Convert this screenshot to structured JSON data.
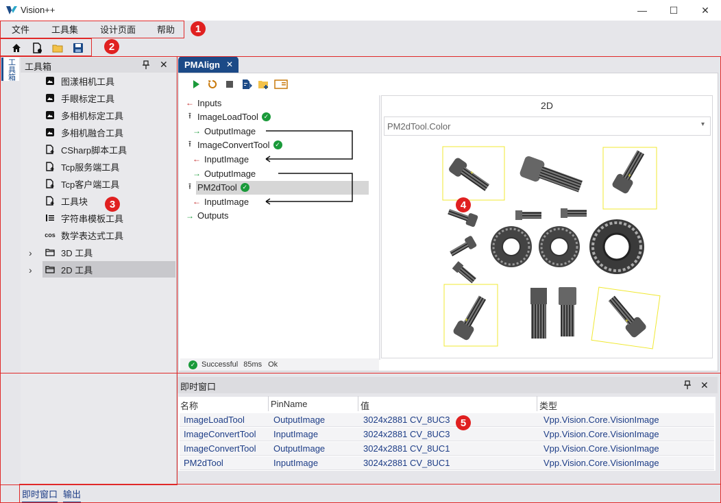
{
  "window": {
    "title": "Vision++",
    "minimize_glyph": "—",
    "maximize_glyph": "☐",
    "close_glyph": "✕"
  },
  "menu": [
    "文件",
    "工具集",
    "设计页面",
    "帮助"
  ],
  "toolbar": {
    "icons": [
      "home-icon",
      "new-file-icon",
      "open-folder-icon",
      "save-icon"
    ]
  },
  "side_strip": {
    "tab_label": "工具箱"
  },
  "toolbox": {
    "title": "工具箱",
    "pin_glyph": "📌",
    "close_glyph": "✕",
    "items": [
      {
        "label": "图漾相机工具",
        "icon": "camera-icon"
      },
      {
        "label": "手眼标定工具",
        "icon": "camera-icon"
      },
      {
        "label": "多相机标定工具",
        "icon": "camera-icon"
      },
      {
        "label": "多相机融合工具",
        "icon": "camera-icon"
      },
      {
        "label": "CSharp脚本工具",
        "icon": "script-icon"
      },
      {
        "label": "Tcp服务端工具",
        "icon": "script-icon"
      },
      {
        "label": "Tcp客户端工具",
        "icon": "script-icon"
      },
      {
        "label": "工具块",
        "icon": "script-icon"
      },
      {
        "label": "字符串模板工具",
        "icon": "list-icon"
      },
      {
        "label": "数学表达式工具",
        "icon": "cos-icon",
        "icon_text": "cos"
      }
    ],
    "folders": [
      {
        "label": "3D 工具",
        "expander": "›"
      },
      {
        "label": "2D 工具",
        "expander": "›",
        "selected": true
      }
    ]
  },
  "document": {
    "tab_label": "PMAlign",
    "tab_close": "✕",
    "run_icons": [
      "run-icon",
      "reset-icon",
      "stop-icon",
      "export-icon",
      "folder-add-icon",
      "panel-icon"
    ],
    "flow": [
      {
        "text": "Inputs",
        "arrow": "←",
        "arrow_color": "#c02020",
        "indent": 0
      },
      {
        "text": "ImageLoadTool",
        "arrow": "⭱",
        "arrow_color": "#333333",
        "indent": 0,
        "ok": true
      },
      {
        "text": "OutputImage",
        "arrow": "→",
        "arrow_color": "#1a9a3a",
        "indent": 1
      },
      {
        "text": "ImageConvertTool",
        "arrow": "⭱",
        "arrow_color": "#333333",
        "indent": 0,
        "ok": true
      },
      {
        "text": "InputImage",
        "arrow": "←",
        "arrow_color": "#c02020",
        "indent": 1
      },
      {
        "text": "OutputImage",
        "arrow": "→",
        "arrow_color": "#1a9a3a",
        "indent": 1
      },
      {
        "text": "PM2dTool",
        "arrow": "⭱",
        "arrow_color": "#333333",
        "indent": 0,
        "ok": true,
        "selected": true
      },
      {
        "text": "InputImage",
        "arrow": "←",
        "arrow_color": "#c02020",
        "indent": 1
      },
      {
        "text": "Outputs",
        "arrow": "→",
        "arrow_color": "#1a9a3a",
        "indent": 0
      }
    ],
    "ok_glyph": "✓",
    "status": {
      "result": "Successful",
      "time": "85ms",
      "message": "Ok"
    },
    "view": {
      "title": "2D",
      "select_value": "PM2dTool.Color",
      "select_arrow": "▾"
    }
  },
  "output": {
    "title": "即时窗口",
    "pin_glyph": "📌",
    "close_glyph": "✕",
    "columns": [
      "名称",
      "PinName",
      "值",
      "类型"
    ],
    "rows": [
      [
        "ImageLoadTool",
        "OutputImage",
        "3024x2881 CV_8UC3",
        "Vpp.Vision.Core.VisionImage"
      ],
      [
        "ImageConvertTool",
        "InputImage",
        "3024x2881 CV_8UC3",
        "Vpp.Vision.Core.VisionImage"
      ],
      [
        "ImageConvertTool",
        "OutputImage",
        "3024x2881 CV_8UC1",
        "Vpp.Vision.Core.VisionImage"
      ],
      [
        "PM2dTool",
        "InputImage",
        "3024x2881 CV_8UC1",
        "Vpp.Vision.Core.VisionImage"
      ]
    ]
  },
  "bottom_tabs": [
    "即时窗口",
    "输出"
  ],
  "annotations": [
    "1",
    "2",
    "3",
    "4",
    "5"
  ],
  "colors": {
    "accent": "#1c4a87",
    "annotation": "#e02020",
    "ok": "#1a9a3a",
    "match_box": "#f0e830"
  }
}
